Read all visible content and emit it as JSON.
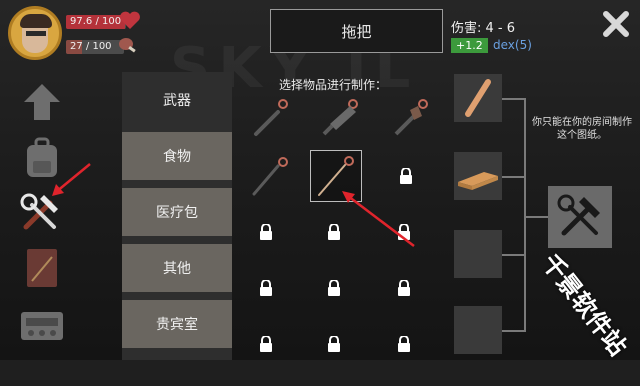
{
  "player": {
    "health_text": "97.6 / 100",
    "health_fraction": 0.976,
    "hunger_text": "27 / 100",
    "hunger_fraction": 0.27
  },
  "nav": {
    "items": [
      {
        "icon": "up-arrow-icon"
      },
      {
        "icon": "backpack-icon"
      },
      {
        "icon": "crafting-tools-icon",
        "active": true
      },
      {
        "icon": "journal-icon"
      },
      {
        "icon": "radio-icon"
      }
    ]
  },
  "tabs": [
    {
      "label": "武器",
      "active": true
    },
    {
      "label": "食物"
    },
    {
      "label": "医疗包"
    },
    {
      "label": "其他"
    },
    {
      "label": "贵宾室"
    }
  ],
  "item": {
    "name": "拖把",
    "stats_title": "伤害: 4 - 6",
    "bonus_value": "+1.2",
    "bonus_stat": "dex(5)"
  },
  "select_hint": "选择物品进行制作：",
  "blueprint_note": "你只能在你的房间制作这个图纸。",
  "watermark": "千景软件站",
  "colors": {
    "health": "#b4323a",
    "bonus_green": "#3c9a3c",
    "dex_blue": "#6aa0e0",
    "annotation_red": "#e0242c"
  }
}
